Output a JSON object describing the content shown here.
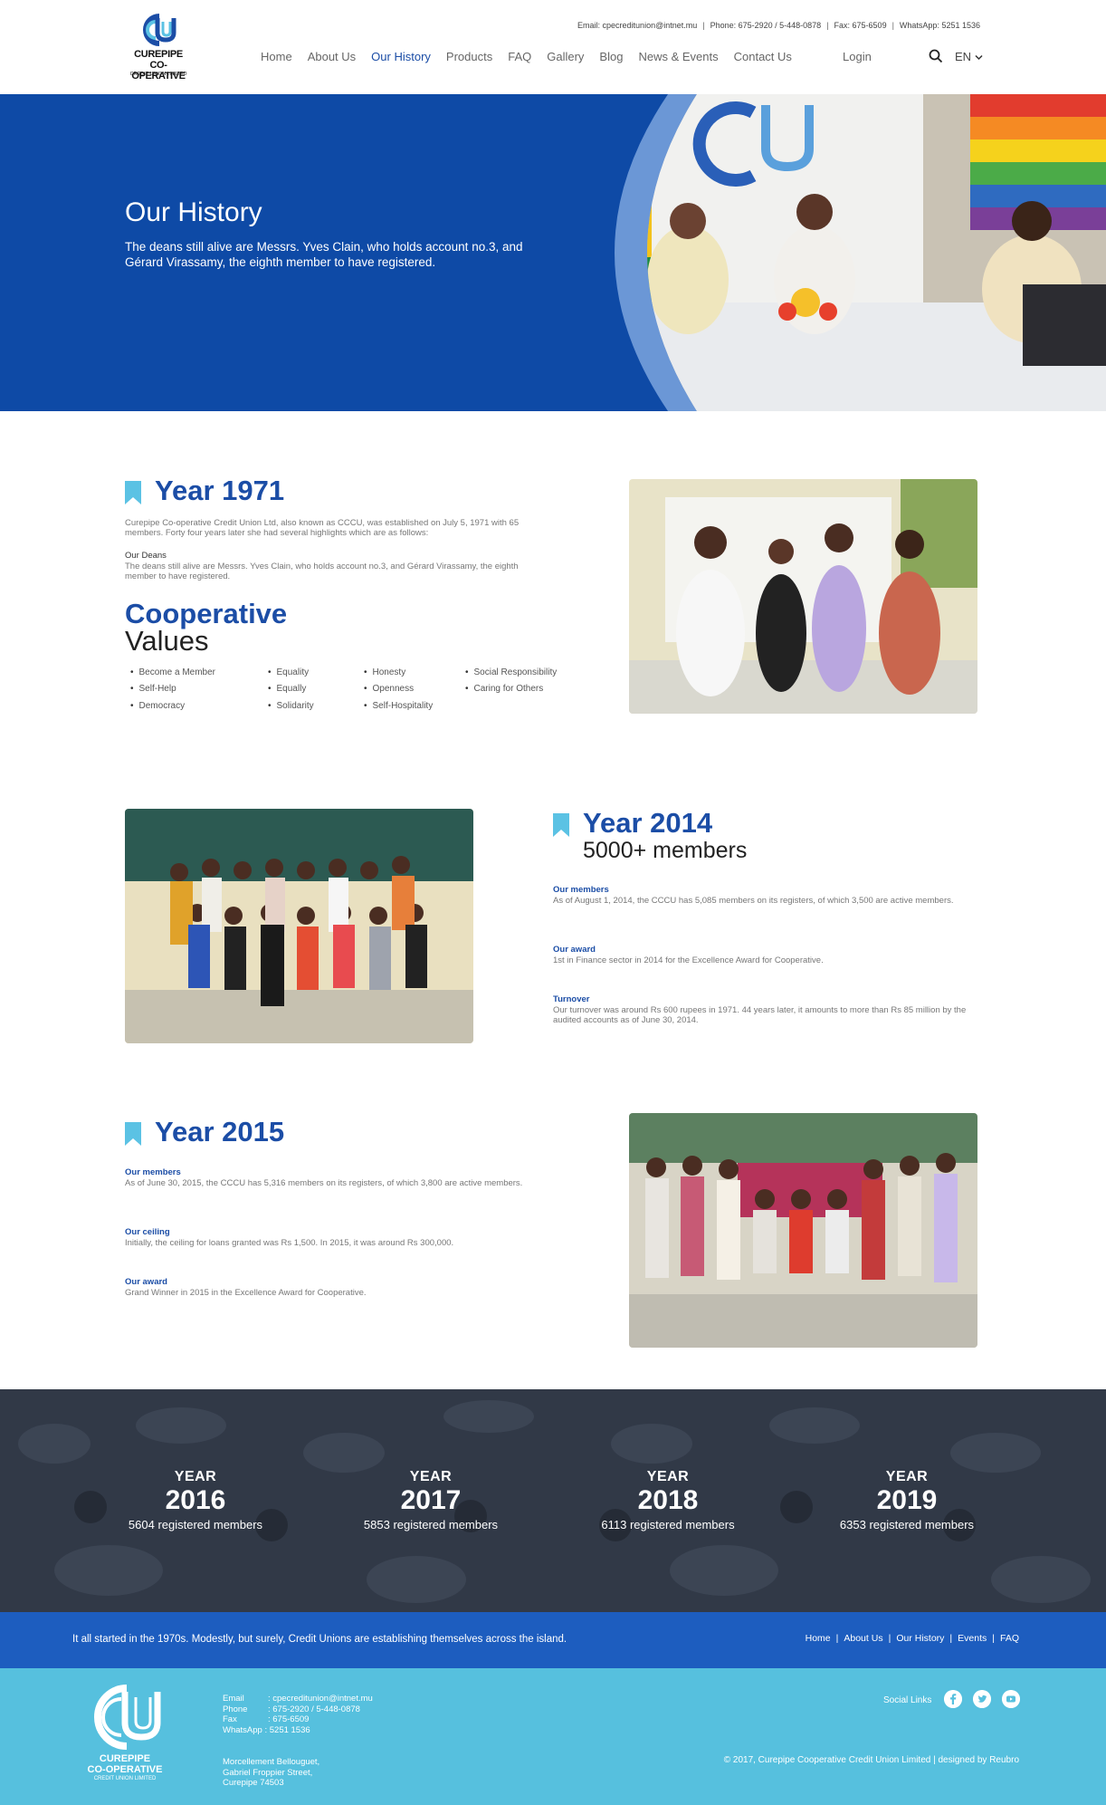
{
  "colors": {
    "primary": "#1b4da6",
    "hero": "#0e4aa6",
    "footer_dark": "#1d5dbf",
    "footer_light": "#56c0de",
    "accent_light": "#5bc2e4"
  },
  "header": {
    "logo": {
      "line1": "CUREPIPE",
      "line2": "CO-OPERATIVE",
      "line3": "CREDIT UNION LIMITED"
    },
    "contact": {
      "email": "Email: cpecreditunion@intnet.mu",
      "phone": "Phone: 675-2920 / 5-448-0878",
      "fax": "Fax: 675-6509",
      "whatsapp": "WhatsApp: 5251 1536"
    },
    "nav": [
      {
        "label": "Home"
      },
      {
        "label": "About Us"
      },
      {
        "label": "Our History"
      },
      {
        "label": "Products"
      },
      {
        "label": "FAQ"
      },
      {
        "label": "Gallery"
      },
      {
        "label": "Blog"
      },
      {
        "label": "News & Events"
      },
      {
        "label": "Contact Us"
      }
    ],
    "login": "Login",
    "language": "EN",
    "icons": {
      "search": "search-icon",
      "dropdown": "chevron-down-icon"
    }
  },
  "hero": {
    "title": "Our History",
    "text": "The deans still alive are Messrs. Yves Clain, who holds account no.3, and Gérard Virassamy, the eighth member to have registered."
  },
  "section1971": {
    "year": "Year 1971",
    "intro": "Curepipe Co-operative Credit Union Ltd, also known as CCCU, was established on July 5, 1971 with 65 members. Forty four years later she had several highlights which are as follows:",
    "deans_head": "Our Deans",
    "deans_text": "The deans still alive are Messrs. Yves Clain, who holds account no.3, and Gérard Virassamy, the eighth member to have registered.",
    "values_title": "Cooperative",
    "values_sub": "Values",
    "values": [
      "Become a Member",
      "Self-Help",
      "Democracy",
      "Equality",
      "Equally",
      "Solidarity",
      "Honesty",
      "Openness",
      "Self-Hospitality",
      "Social Responsibility",
      "Caring for Others"
    ]
  },
  "section2014": {
    "year": "Year 2014",
    "sub": "5000+ members",
    "members_head": "Our members",
    "members_text": "As of August 1, 2014, the CCCU has 5,085 members on its registers, of which 3,500 are active members.",
    "award_head": "Our award",
    "award_text": "1st in Finance sector in 2014 for the Excellence Award for Cooperative.",
    "turnover_head": "Turnover",
    "turnover_text": "Our turnover was around Rs 600 rupees in 1971. 44 years later, it amounts to more than Rs 85 million by the audited accounts as of June 30, 2014."
  },
  "section2015": {
    "year": "Year 2015",
    "members_head": "Our members",
    "members_text": "As of June 30, 2015, the CCCU has 5,316 members on its registers, of which 3,800 are active members.",
    "ceiling_head": "Our ceiling",
    "ceiling_text": "Initially, the ceiling for loans granted was Rs 1,500. In 2015, it was around Rs 300,000.",
    "award_head": "Our award",
    "award_text": "Grand Winner in 2015 in the Excellence Award for Cooperative."
  },
  "stats": [
    {
      "label": "YEAR",
      "year": "2016",
      "members": "5604 registered members"
    },
    {
      "label": "YEAR",
      "year": "2017",
      "members": "5853 registered members"
    },
    {
      "label": "YEAR",
      "year": "2018",
      "members": "6113 registered members"
    },
    {
      "label": "YEAR",
      "year": "2019",
      "members": "6353 registered members"
    }
  ],
  "footer": {
    "tagline": "It all started in the 1970s. Modestly, but surely, Credit Unions are establishing themselves across the island.",
    "links": [
      {
        "label": "Home"
      },
      {
        "label": "About Us"
      },
      {
        "label": "Our History"
      },
      {
        "label": "Events"
      },
      {
        "label": "FAQ"
      }
    ],
    "email_label": "Email",
    "email": ": cpecreditunion@intnet.mu",
    "phone_label": "Phone",
    "phone": ": 675-2920 / 5-448-0878",
    "fax_label": "Fax",
    "fax": ": 675-6509",
    "whatsapp_label": "WhatsApp",
    "whatsapp": ": 5251 1536",
    "address1": "Morcellement Bellouguet,",
    "address2": "Gabriel Froppier Street,",
    "address3": "Curepipe 74503",
    "social_label": "Social Links",
    "copyright": "© 2017, Curepipe Cooperative Credit Union Limited | designed by Reubro",
    "logo": {
      "line1": "CUREPIPE",
      "line2": "CO-OPERATIVE",
      "line3": "CREDIT UNION LIMITED"
    }
  }
}
